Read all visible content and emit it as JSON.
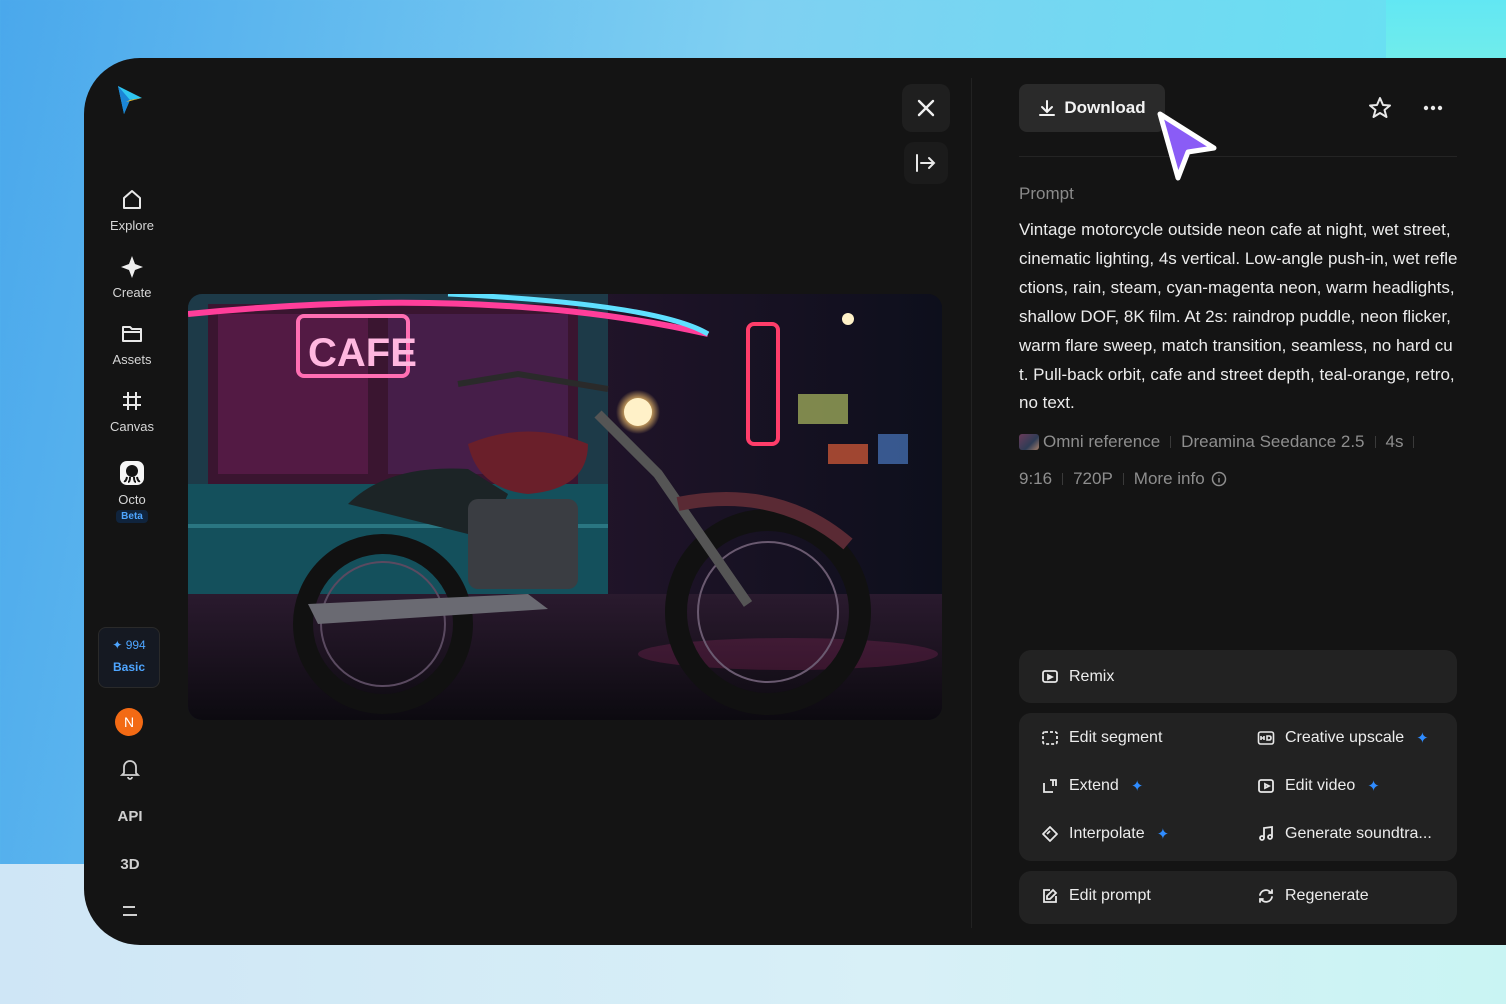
{
  "sidebar": {
    "items": [
      {
        "label": "Explore",
        "icon": "home-icon"
      },
      {
        "label": "Create",
        "icon": "sparkle-icon"
      },
      {
        "label": "Assets",
        "icon": "folder-icon"
      },
      {
        "label": "Canvas",
        "icon": "canvas-icon"
      },
      {
        "label": "Octo",
        "icon": "octo-icon",
        "badge": "Beta"
      }
    ],
    "credits": {
      "amount": "994",
      "tier": "Basic"
    },
    "avatar_initial": "N",
    "api_label": "API",
    "three_d_label": "3D"
  },
  "panel": {
    "download_label": "Download",
    "prompt_label": "Prompt",
    "prompt_text": "Vintage motorcycle outside neon cafe at night, wet street, cinematic lighting, 4s vertical. Low-angle push-in, wet reflections, rain, steam, cyan-magenta neon, warm headlights, shallow DOF, 8K film. At 2s: raindrop puddle, neon flicker, warm flare sweep, match transition, seamless, no hard cut. Pull-back orbit, cafe and street depth, teal-orange, retro, no text.",
    "meta": {
      "reference": "Omni reference",
      "model": "Dreamina Seedance 2.5",
      "duration": "4s",
      "ratio": "9:16",
      "resolution": "720P",
      "more_info": "More info"
    },
    "remix_label": "Remix",
    "tools": {
      "edit_segment": "Edit segment",
      "creative_upscale": "Creative upscale",
      "extend": "Extend",
      "edit_video": "Edit video",
      "interpolate": "Interpolate",
      "generate_soundtrack": "Generate soundtra...",
      "edit_prompt": "Edit prompt",
      "regenerate": "Regenerate"
    }
  },
  "image": {
    "sign_text": "CAFE"
  }
}
